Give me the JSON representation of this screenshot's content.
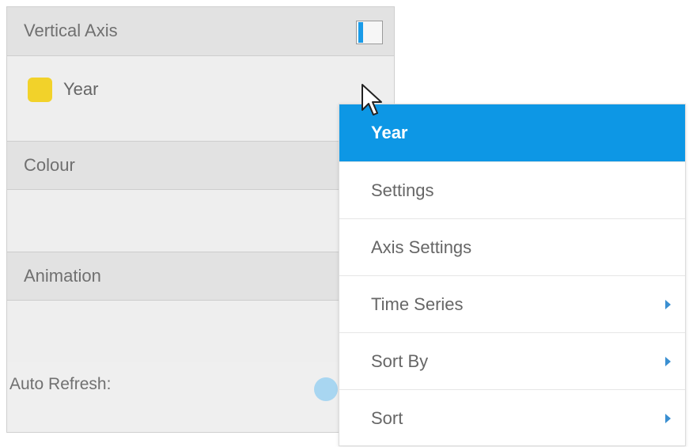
{
  "panel": {
    "sections": [
      {
        "title": "Vertical Axis",
        "field": {
          "label": "Year",
          "color": "#f2d22a"
        }
      },
      {
        "title": "Colour"
      },
      {
        "title": "Animation"
      }
    ],
    "auto_refresh_label": "Auto Refresh:"
  },
  "context_menu": {
    "items": [
      {
        "label": "Year",
        "active": true
      },
      {
        "label": "Settings"
      },
      {
        "label": "Axis Settings"
      },
      {
        "label": "Time Series",
        "submenu": true
      },
      {
        "label": "Sort By",
        "submenu": true
      },
      {
        "label": "Sort",
        "submenu": true
      }
    ]
  },
  "colors": {
    "accent": "#0d97e5",
    "field_chip": "#f2d22a",
    "toggle": "#a8d6f1"
  },
  "icons": {
    "layout_toggle": "panel-toggle-icon",
    "cursor": "mouse-pointer-icon",
    "submenu": "chevron-right-icon"
  }
}
